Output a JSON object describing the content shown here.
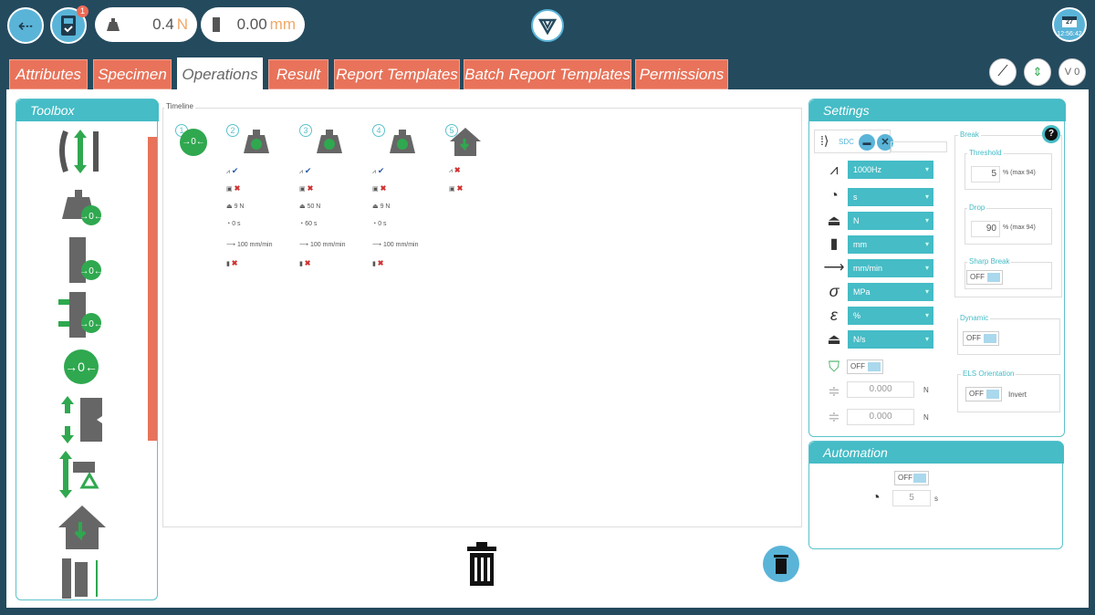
{
  "topbar": {
    "notification_count": "1",
    "force_value": "0.4",
    "force_unit": "N",
    "position_value": "0.00",
    "position_unit": "mm",
    "calendar_day": "27",
    "time": "12:56:42"
  },
  "tabs": [
    "Attributes",
    "Specimen",
    "Operations",
    "Result",
    "Report Templates",
    "Batch Report Templates",
    "Permissions"
  ],
  "active_tab": "Operations",
  "version_label": "V 0",
  "toolbox": {
    "title": "Toolbox"
  },
  "timeline": {
    "label": "Timeline",
    "steps": [
      {
        "num": "1"
      },
      {
        "num": "2",
        "force": "9 N",
        "time": "0 s",
        "speed": "100 mm/min"
      },
      {
        "num": "3",
        "force": "50 N",
        "time": "60 s",
        "speed": "100 mm/min"
      },
      {
        "num": "4",
        "force": "9 N",
        "time": "0 s",
        "speed": "100 mm/min"
      },
      {
        "num": "5"
      }
    ]
  },
  "settings": {
    "title": "Settings",
    "sdc_label": "SDC",
    "selects": [
      "1000Hz",
      "s",
      "N",
      "mm",
      "mm/min",
      "MPa",
      "%",
      "N/s"
    ],
    "toggle_off": "OFF",
    "zero_value_1": "0.000",
    "zero_value_2": "0.000",
    "zero_unit": "N",
    "break": {
      "label": "Break",
      "threshold_label": "Threshold",
      "threshold_value": "5",
      "threshold_suffix": "% (max 94)",
      "drop_label": "Drop",
      "drop_value": "90",
      "drop_suffix": "% (max 94)",
      "sharp_break_label": "Sharp Break",
      "sharp_break_state": "OFF"
    },
    "dynamic": {
      "label": "Dynamic",
      "state": "OFF"
    },
    "els": {
      "label": "ELS Orientation",
      "state": "OFF",
      "invert_label": "Invert"
    }
  },
  "automation": {
    "title": "Automation",
    "state": "OFF",
    "time_value": "5",
    "time_unit": "s"
  },
  "colors": {
    "accent": "#45bcc6",
    "tab": "#e8735a",
    "background": "#244a5e",
    "green": "#2fa84f"
  }
}
